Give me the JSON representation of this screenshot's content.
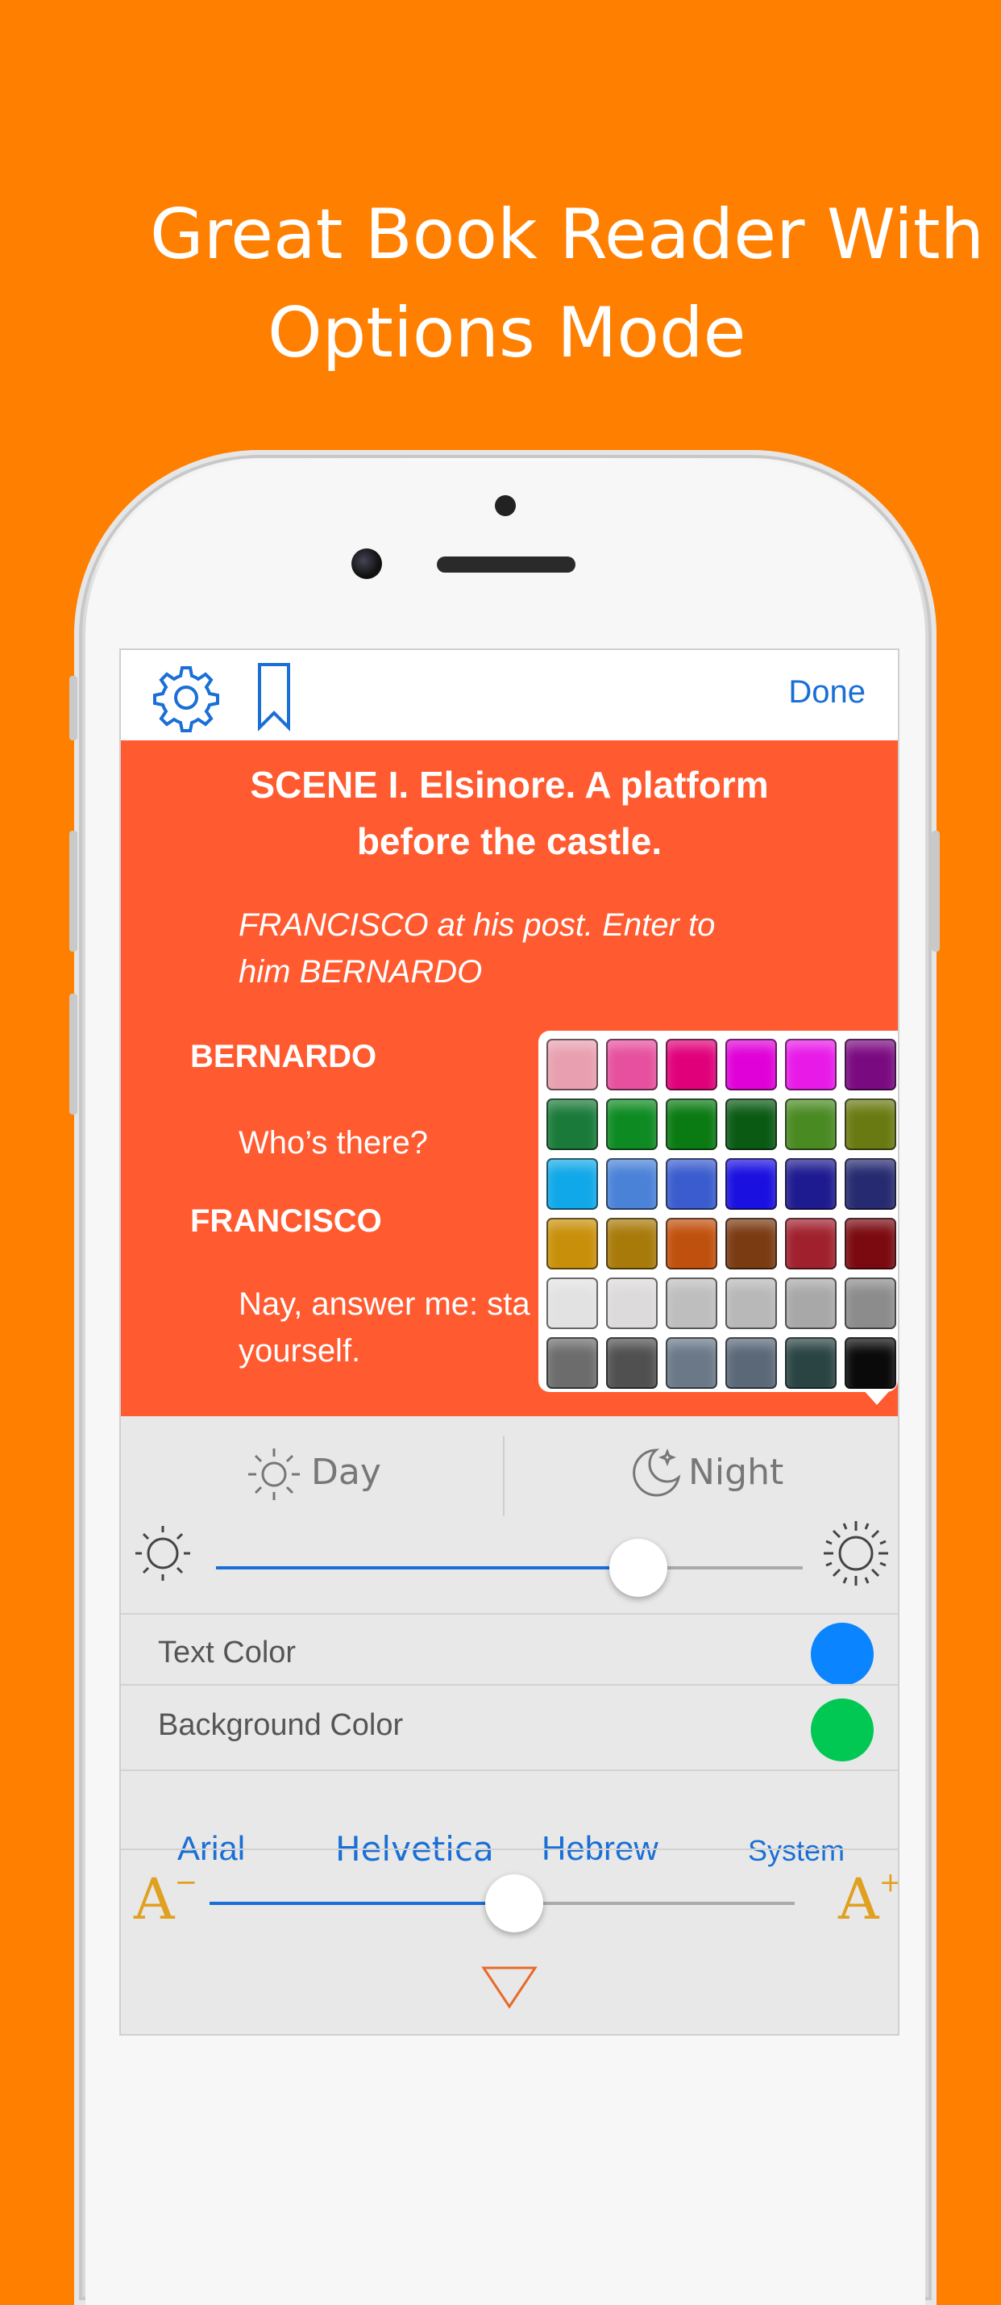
{
  "headline": {
    "line1": "Great Book Reader With",
    "line2": "Options Mode"
  },
  "navbar": {
    "done_label": "Done"
  },
  "reader": {
    "scene_title_1": "SCENE I. Elsinore. A platform",
    "scene_title_2": "before the castle.",
    "stage_1": "FRANCISCO at his post. Enter to",
    "stage_2": "him BERNARDO",
    "speaker_1": "BERNARDO",
    "line_1": "Who’s there?",
    "speaker_2": "FRANCISCO",
    "line_2a": "Nay, answer me: sta",
    "line_2b": "yourself."
  },
  "palette": {
    "colors": [
      [
        "#E8A0B0",
        "#E6509E",
        "#E0007A",
        "#E000D8",
        "#E81AE8",
        "#7A0A80"
      ],
      [
        "#1A7A3A",
        "#0E8A22",
        "#0A7A12",
        "#0A5A14",
        "#4A8A22",
        "#6A7A12"
      ],
      [
        "#10A8E8",
        "#4A82D8",
        "#3A5CCE",
        "#1A10E0",
        "#1E1A90",
        "#262A70"
      ],
      [
        "#C8900A",
        "#A87A0A",
        "#C0500E",
        "#7A3A12",
        "#A0202E",
        "#7A0A10"
      ],
      [
        "#E2E2E2",
        "#DCDADA",
        "#BEBEBE",
        "#B8B8B8",
        "#A8A8A8",
        "#8C8C8C"
      ],
      [
        "#6C6C6C",
        "#505050",
        "#6A7888",
        "#5A6878",
        "#2A4444",
        "#0A0A0A"
      ]
    ]
  },
  "mode": {
    "day_label": "Day",
    "night_label": "Night"
  },
  "brightness": {
    "value": 0.72
  },
  "colors_section": {
    "text_color_label": "Text Color",
    "text_color_value": "#0A84FF",
    "bg_color_label": "Background Color",
    "bg_color_value": "#00C853"
  },
  "fonts": {
    "options": [
      "Arial",
      "Helvetica",
      "Hebrew",
      "System"
    ]
  },
  "font_size": {
    "value": 0.52,
    "decrease_label": "A",
    "increase_label": "A",
    "decrease_mark": "−",
    "increase_mark": "+"
  },
  "accent": "#1a6fd6"
}
